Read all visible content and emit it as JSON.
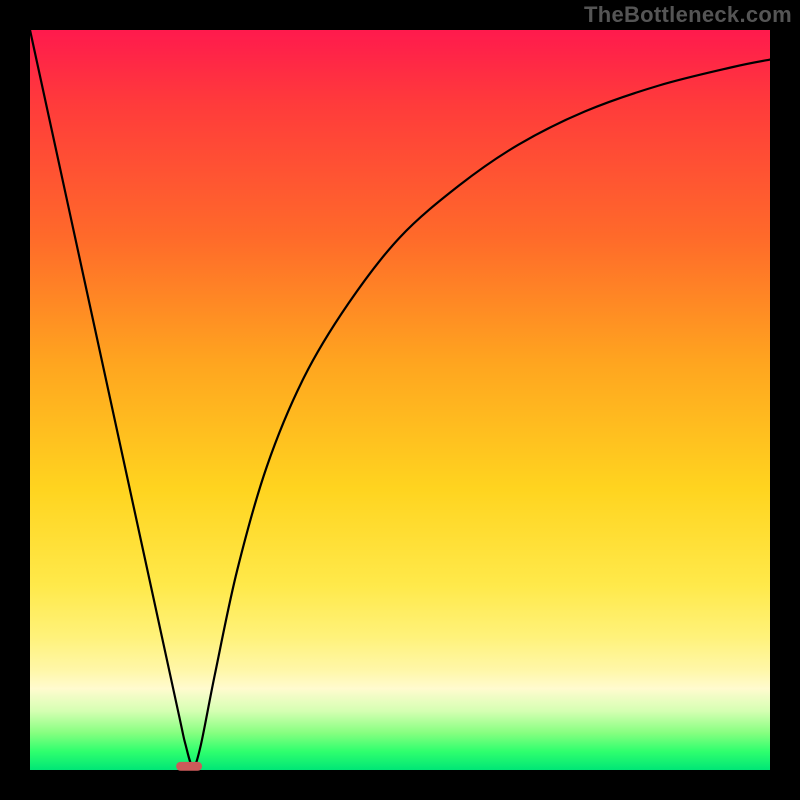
{
  "watermark": "TheBottleneck.com",
  "chart_data": {
    "type": "line",
    "title": "",
    "xlabel": "",
    "ylabel": "",
    "xlim": [
      0,
      100
    ],
    "ylim": [
      0,
      100
    ],
    "grid": false,
    "series": [
      {
        "name": "curve",
        "x": [
          0,
          5,
          10,
          15,
          20,
          21,
          22,
          23,
          25,
          28,
          32,
          37,
          43,
          50,
          58,
          66,
          75,
          85,
          95,
          100
        ],
        "y": [
          100,
          77,
          54,
          31,
          8,
          3.5,
          0.5,
          3,
          13,
          27,
          41,
          53,
          63,
          72,
          79,
          84.5,
          89,
          92.5,
          95,
          96
        ]
      }
    ],
    "marker": {
      "x": 21.5,
      "y": 0.5,
      "w": 3.5,
      "h": 1.2
    },
    "background_gradient": {
      "direction": "vertical",
      "stops": [
        {
          "pos": 0.0,
          "color": "#ff1a4d"
        },
        {
          "pos": 0.28,
          "color": "#ff6a2a"
        },
        {
          "pos": 0.62,
          "color": "#ffd41f"
        },
        {
          "pos": 0.89,
          "color": "#fffbcf"
        },
        {
          "pos": 1.0,
          "color": "#00e676"
        }
      ]
    }
  }
}
